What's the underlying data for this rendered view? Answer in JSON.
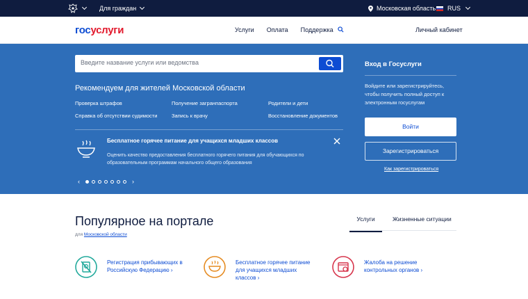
{
  "topbar": {
    "for_citizens": "Для граждан",
    "region": "Московская область",
    "language": "RUS"
  },
  "header": {
    "logo_part1": "гос",
    "logo_part2": "услуги",
    "nav": [
      "Услуги",
      "Оплата",
      "Поддержка"
    ],
    "cabinet": "Личный кабинет"
  },
  "hero": {
    "search_placeholder": "Введите название услуги или ведомства",
    "recommend_title": "Рекомендуем для жителей Московской области",
    "links": [
      "Проверка штрафов",
      "Получение загранпаспорта",
      "Родители и дети",
      "Справка об отсутствии судимости",
      "Запись к врачу",
      "Восстановление документов"
    ],
    "notice_title": "Бесплатное горячее питание для учащихся младших классов",
    "notice_text": "Оценить качество предоставления бесплатного горячего питания для обучающихся по образовательным программам начального общего образования",
    "pager_count": 7,
    "pager_active_index": 0
  },
  "login": {
    "title": "Вход в Госуслуги",
    "description": "Войдите или зарегистрируйтесь, чтобы получить полный доступ к электронным госуслугам",
    "login_button": "Войти",
    "register_button": "Зарегистрироваться",
    "how_to_register": "Как зарегистрироваться"
  },
  "popular": {
    "title": "Популярное на портале",
    "for_prefix": "для",
    "region_link": "Московской области",
    "tabs": [
      "Услуги",
      "Жизненные ситуации"
    ],
    "cards": [
      {
        "text": "Регистрация прибывающих в Российскую Федерацию",
        "color": "#1fa89a",
        "icon": "no-passport-icon"
      },
      {
        "text": "Бесплатное горячее питание для учащихся младших классов",
        "color": "#e58a1f",
        "icon": "hot-meal-icon"
      },
      {
        "text": "Жалоба на решение контрольных органов",
        "color": "#d6334a",
        "icon": "complaint-icon"
      }
    ]
  },
  "colors": {
    "topbar": "#0f1c3f",
    "hero": "#2e6eb9",
    "brand_blue": "#0d4cd3",
    "brand_red": "#e2192c"
  }
}
